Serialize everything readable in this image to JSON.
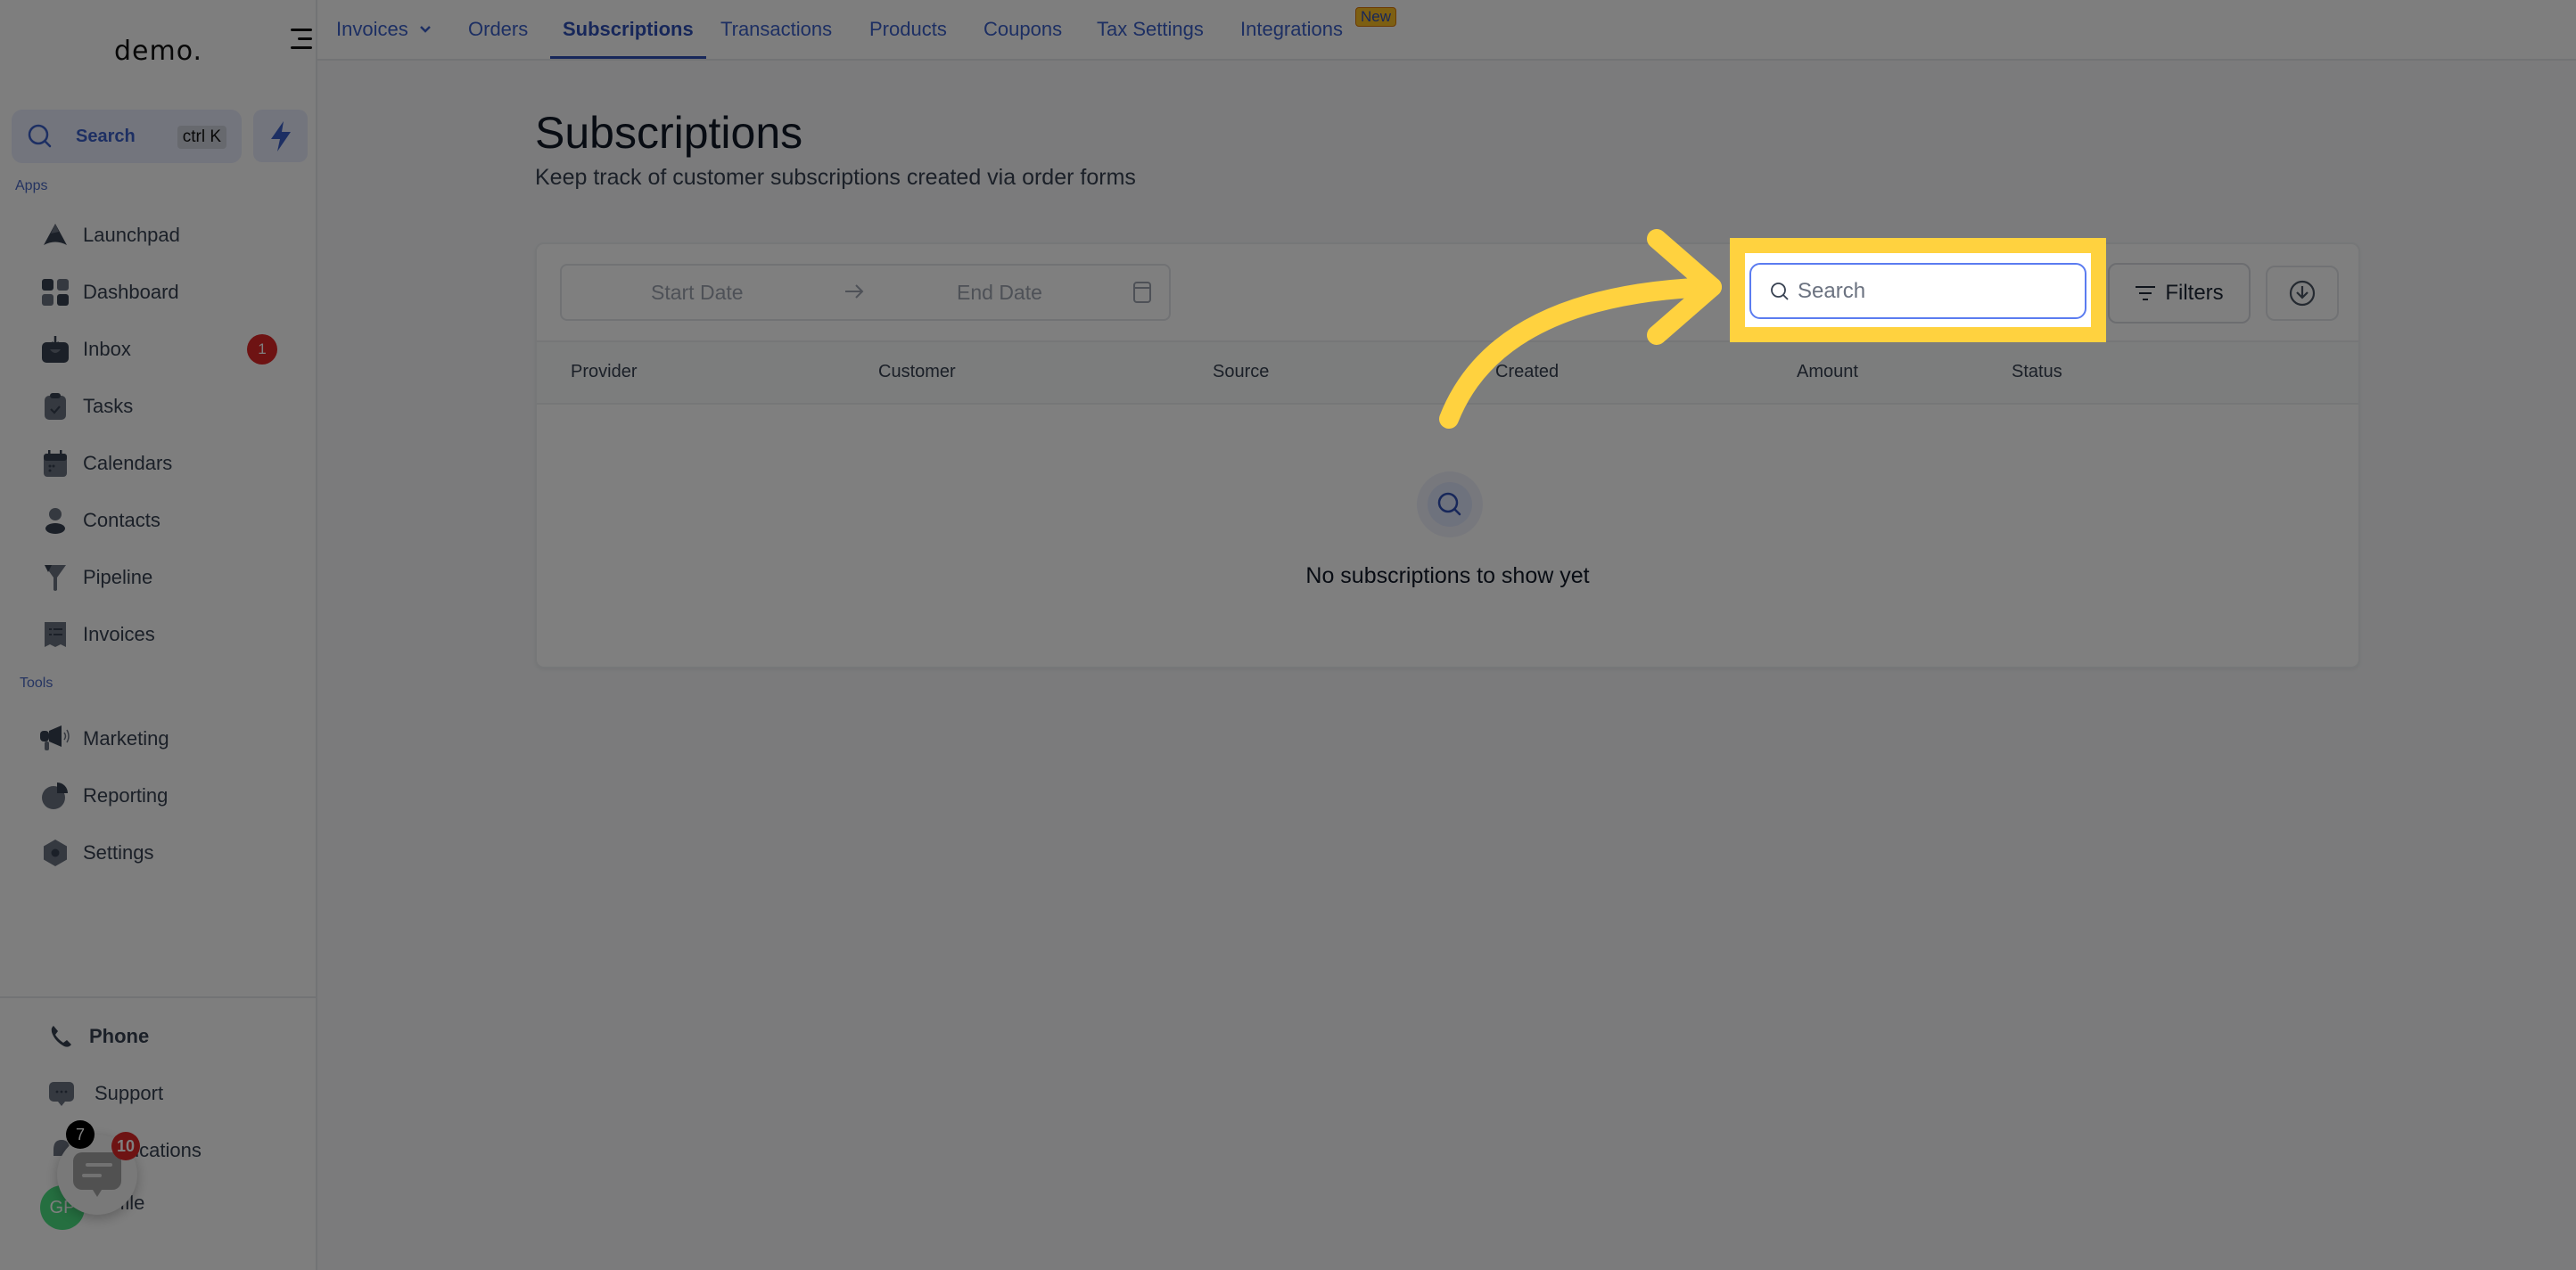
{
  "sidebar": {
    "logo": "demo.",
    "search": {
      "label": "Search",
      "shortcut": "ctrl K"
    },
    "sections": {
      "apps": "Apps",
      "tools": "Tools"
    },
    "apps": [
      {
        "label": "Launchpad",
        "icon": "rocket-icon"
      },
      {
        "label": "Dashboard",
        "icon": "grid-icon"
      },
      {
        "label": "Inbox",
        "icon": "inbox-icon",
        "badge": "1"
      },
      {
        "label": "Tasks",
        "icon": "clipboard-check-icon"
      },
      {
        "label": "Calendars",
        "icon": "calendar-icon"
      },
      {
        "label": "Contacts",
        "icon": "person-icon"
      },
      {
        "label": "Pipeline",
        "icon": "funnel-icon"
      },
      {
        "label": "Invoices",
        "icon": "receipt-icon"
      }
    ],
    "tools": [
      {
        "label": "Marketing",
        "icon": "megaphone-icon"
      },
      {
        "label": "Reporting",
        "icon": "pie-chart-icon"
      },
      {
        "label": "Settings",
        "icon": "hexagon-gear-icon"
      }
    ],
    "bottom": [
      {
        "label": "Phone",
        "icon": "phone-icon"
      },
      {
        "label": "Support",
        "icon": "chat-bubble-icon"
      },
      {
        "label": "Notifications",
        "icon": "bell-icon"
      },
      {
        "label": "Profile",
        "icon": "avatar"
      }
    ],
    "avatar_initials": "GP",
    "chat_widget": {
      "unread_badge": "10",
      "notif_badge": "7"
    }
  },
  "topnav": {
    "tabs": [
      {
        "label": "Invoices",
        "has_dropdown": true
      },
      {
        "label": "Orders"
      },
      {
        "label": "Subscriptions",
        "active": true
      },
      {
        "label": "Transactions"
      },
      {
        "label": "Products"
      },
      {
        "label": "Coupons"
      },
      {
        "label": "Tax Settings"
      },
      {
        "label": "Integrations",
        "badge": "New"
      }
    ]
  },
  "page": {
    "title": "Subscriptions",
    "subtitle": "Keep track of customer subscriptions created via order forms"
  },
  "toolbar": {
    "start_date_placeholder": "Start Date",
    "end_date_placeholder": "End Date",
    "search_placeholder": "Search",
    "search_value": "",
    "filters_label": "Filters"
  },
  "table": {
    "columns": [
      "Provider",
      "Customer",
      "Source",
      "Created",
      "Amount",
      "Status"
    ],
    "rows": [],
    "empty_message": "No subscriptions to show yet"
  },
  "annotation": {
    "highlight_color": "#ffd23f",
    "target": "search-input"
  },
  "colors": {
    "accent": "#3b5fc7",
    "badge_red": "#dc2626",
    "new_badge": "#fbbf24"
  }
}
